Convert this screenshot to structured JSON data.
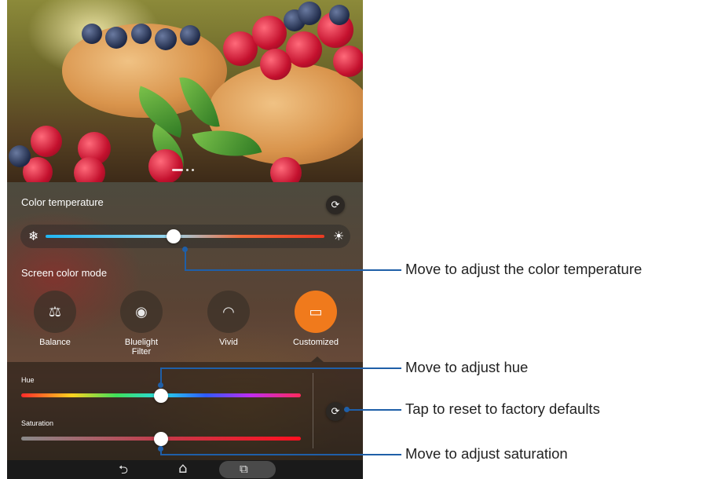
{
  "color_temperature": {
    "title": "Color temperature",
    "cool_icon": "❄",
    "warm_icon": "☀",
    "reset_icon": "⟳",
    "value_percent": 46
  },
  "screen_color_mode": {
    "title": "Screen color mode",
    "modes": [
      {
        "label": "Balance",
        "icon": "⚖",
        "active": false
      },
      {
        "label": "Bluelight Filter",
        "icon": "◉",
        "active": false
      },
      {
        "label": "Vivid",
        "icon": "◠",
        "active": false
      },
      {
        "label": "Customized",
        "icon": "▭",
        "active": true
      }
    ]
  },
  "customize": {
    "hue_label": "Hue",
    "saturation_label": "Saturation",
    "hue_percent": 50,
    "saturation_percent": 50,
    "reset_icon": "⟳"
  },
  "navbar": {
    "back_icon": "⮌",
    "home_icon": "⌂",
    "recents_icon": "⧉"
  },
  "callouts": {
    "color_temperature": "Move to adjust the color temperature",
    "hue": "Move to adjust hue",
    "reset": "Tap to reset to factory defaults",
    "saturation": "Move to adjust saturation"
  },
  "colors": {
    "accent": "#f07a1c",
    "callout": "#1f5fa8"
  }
}
